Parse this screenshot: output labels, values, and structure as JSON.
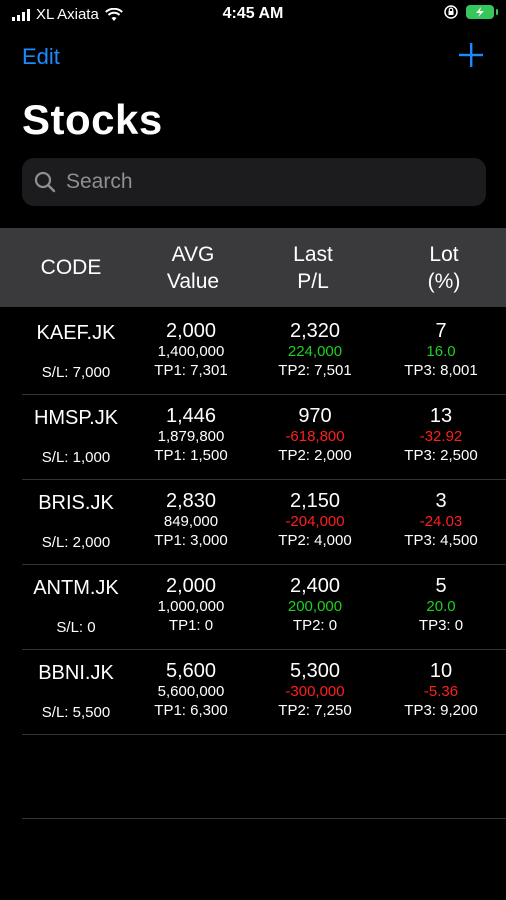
{
  "status_bar": {
    "carrier": "XL Axiata",
    "time": "4:45 AM"
  },
  "nav": {
    "edit_label": "Edit",
    "add_icon": "plus-icon"
  },
  "page_title": "Stocks",
  "search": {
    "placeholder": "Search"
  },
  "table": {
    "headers": {
      "code": "CODE",
      "avg_line1": "AVG",
      "avg_line2": "Value",
      "last_line1": "Last",
      "last_line2": "P/L",
      "lot_line1": "Lot",
      "lot_line2": "(%)"
    },
    "rows": [
      {
        "code": "KAEF.JK",
        "sl": "S/L: 7,000",
        "avg": "2,000",
        "avg_value": "1,400,000",
        "tp1": "TP1: 7,301",
        "last": "2,320",
        "pl": "224,000",
        "tp2": "TP2: 7,501",
        "lot": "7",
        "pct": "16.0",
        "tp3": "TP3: 8,001",
        "trend": "up"
      },
      {
        "code": "HMSP.JK",
        "sl": "S/L: 1,000",
        "avg": "1,446",
        "avg_value": "1,879,800",
        "tp1": "TP1: 1,500",
        "last": "970",
        "pl": "-618,800",
        "tp2": "TP2: 2,000",
        "lot": "13",
        "pct": "-32.92",
        "tp3": "TP3: 2,500",
        "trend": "down"
      },
      {
        "code": "BRIS.JK",
        "sl": "S/L: 2,000",
        "avg": "2,830",
        "avg_value": "849,000",
        "tp1": "TP1: 3,000",
        "last": "2,150",
        "pl": "-204,000",
        "tp2": "TP2: 4,000",
        "lot": "3",
        "pct": "-24.03",
        "tp3": "TP3: 4,500",
        "trend": "down"
      },
      {
        "code": "ANTM.JK",
        "sl": "S/L: 0",
        "avg": "2,000",
        "avg_value": "1,000,000",
        "tp1": "TP1: 0",
        "last": "2,400",
        "pl": "200,000",
        "tp2": "TP2: 0",
        "lot": "5",
        "pct": "20.0",
        "tp3": "TP3: 0",
        "trend": "up"
      },
      {
        "code": "BBNI.JK",
        "sl": "S/L: 5,500",
        "avg": "5,600",
        "avg_value": "5,600,000",
        "tp1": "TP1: 6,300",
        "last": "5,300",
        "pl": "-300,000",
        "tp2": "TP2: 7,250",
        "lot": "10",
        "pct": "-5.36",
        "tp3": "TP3: 9,200",
        "trend": "down"
      }
    ]
  },
  "colors": {
    "accent": "#1a8cff",
    "gain": "#1fd11f",
    "loss": "#ff1f1f",
    "header_bg": "#3a3a3c"
  }
}
